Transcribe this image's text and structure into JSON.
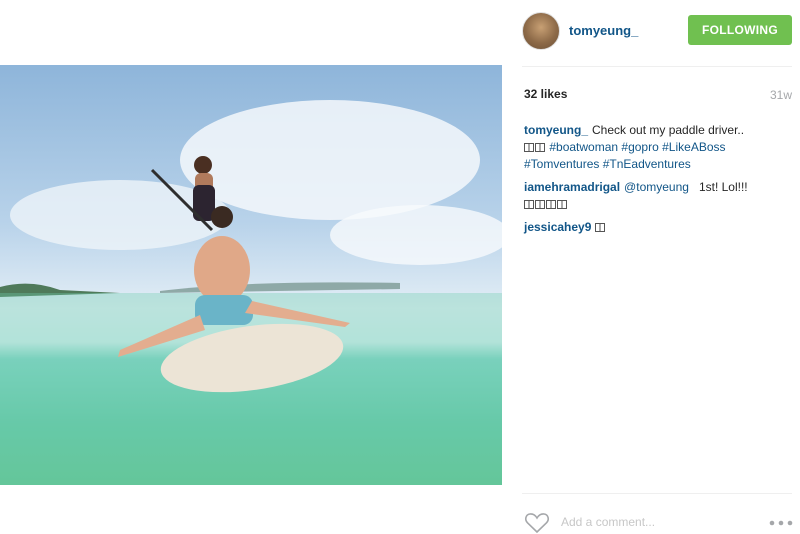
{
  "post": {
    "username": "tomyeung_",
    "follow_label": "FOLLOWING",
    "likes": "32 likes",
    "timestamp": "31w"
  },
  "comments": [
    {
      "author": "tomyeung_",
      "text": "Check out my paddle driver..",
      "emojis": 2,
      "tags": [
        "#boatwoman",
        "#gopro",
        "#LikeABoss",
        "#Tomventures",
        "#TnEadventures"
      ]
    },
    {
      "author": "iamehramadrigal",
      "mention": "@tomyeung",
      "text": "1st! Lol!!!",
      "emojis": 4
    },
    {
      "author": "jessicahey9",
      "emojis": 1
    }
  ],
  "composer": {
    "placeholder": "Add a comment..."
  },
  "icons": {
    "like": "heart-icon",
    "more": "more-options-icon"
  },
  "colors": {
    "follow_button": "#70c050",
    "username": "#125688"
  }
}
